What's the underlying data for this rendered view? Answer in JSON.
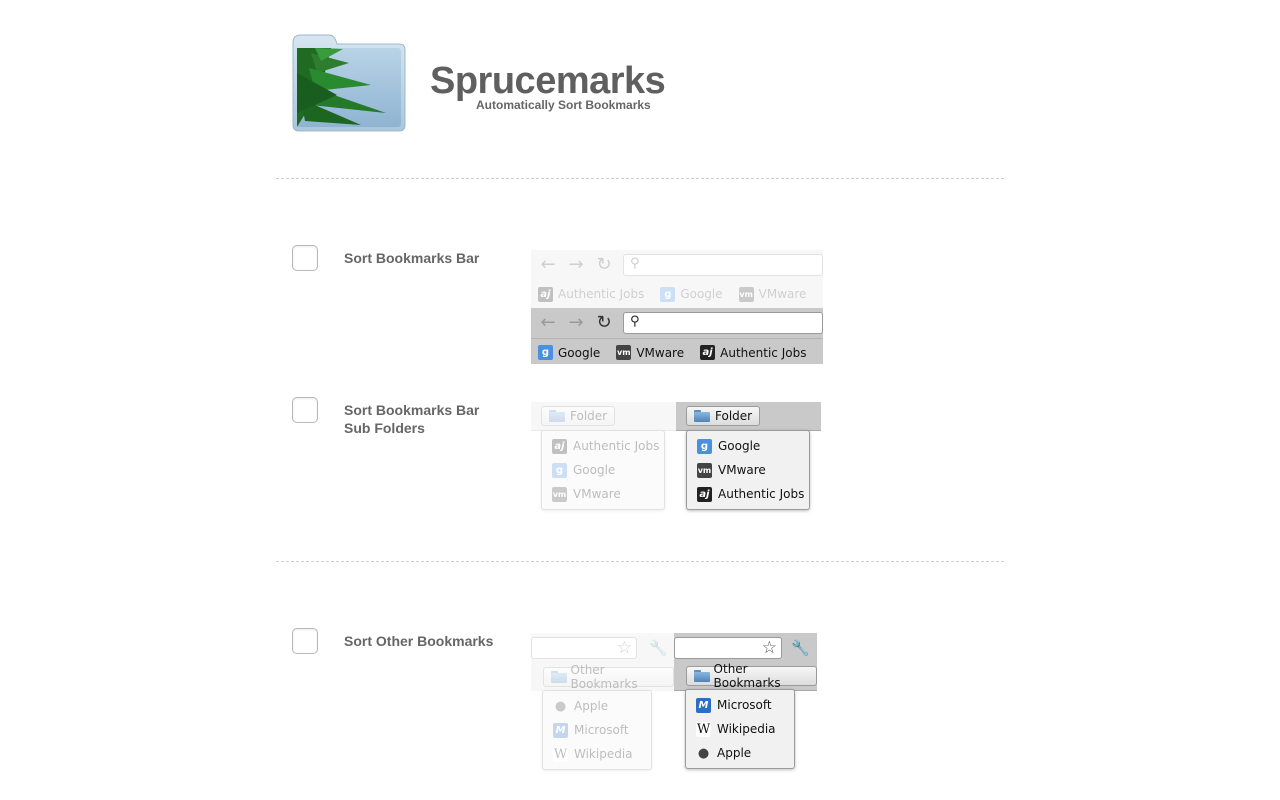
{
  "header": {
    "title": "Sprucemarks",
    "subtitle": "Automatically Sort Bookmarks",
    "logo_icon": "spruce-folder-icon"
  },
  "options": [
    {
      "label_line1": "Sort Bookmarks Bar",
      "label_line2": "",
      "checked": false
    },
    {
      "label_line1": "Sort Bookmarks Bar",
      "label_line2": "Sub Folders",
      "checked": false
    },
    {
      "label_line1": "Sort Other Bookmarks",
      "label_line2": "",
      "checked": false
    }
  ],
  "preview_bar": {
    "before": [
      "Authentic Jobs",
      "Google",
      "VMware"
    ],
    "after": [
      "Google",
      "VMware",
      "Authentic Jobs"
    ]
  },
  "preview_subfolder": {
    "folder_label": "Folder",
    "before": [
      "Authentic Jobs",
      "Google",
      "VMware"
    ],
    "after": [
      "Google",
      "VMware",
      "Authentic Jobs"
    ]
  },
  "preview_other": {
    "folder_label": "Other Bookmarks",
    "before": [
      "Apple",
      "Microsoft",
      "Wikipedia"
    ],
    "after": [
      "Microsoft",
      "Wikipedia",
      "Apple"
    ]
  },
  "colors": {
    "title": "#5f5f5f",
    "toolbar_active": "#c9c9c9",
    "toolbar_faded": "#e6e6e6",
    "divider": "#cfcfcf"
  }
}
